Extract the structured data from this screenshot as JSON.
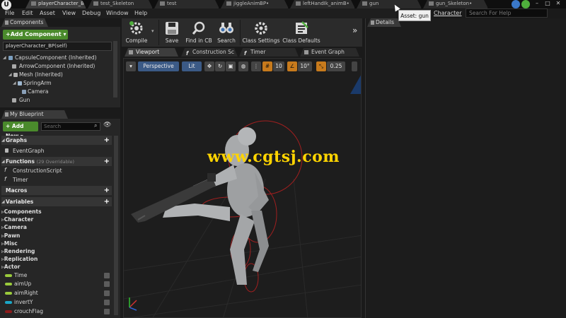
{
  "app": {
    "logo_letter": "U"
  },
  "doc_tabs": [
    {
      "label": "playerCharacter_BP",
      "active": true
    },
    {
      "label": "test_Skeleton",
      "active": false
    },
    {
      "label": "test",
      "active": false
    },
    {
      "label": "jiggleAnimBP•",
      "active": false
    },
    {
      "label": "leftHandIk_animB•",
      "active": false
    },
    {
      "label": "gun",
      "active": false
    },
    {
      "label": "gun_Skeleton•",
      "active": false
    }
  ],
  "menu": [
    "File",
    "Edit",
    "Asset",
    "View",
    "Debug",
    "Window",
    "Help"
  ],
  "tooltip": "Asset: gun",
  "parent_class": "Character",
  "help_search_placeholder": "Search For Help",
  "window_controls": {
    "minimize": "–",
    "maximize": "□",
    "close": "✕"
  },
  "components_panel": {
    "tab": "Components",
    "add_button": "+Add Component",
    "add_button_arrow": "▾",
    "search_value": "playerCharacter_BP(self)",
    "tree": [
      {
        "label": "CapsuleComponent (Inherited)",
        "depth": 0
      },
      {
        "label": "ArrowComponent (Inherited)",
        "depth": 1
      },
      {
        "label": "Mesh (Inherited)",
        "depth": 1
      },
      {
        "label": "SpringArm",
        "depth": 2
      },
      {
        "label": "Camera",
        "depth": 3
      },
      {
        "label": "Gun",
        "depth": 1
      }
    ]
  },
  "my_blueprint": {
    "tab": "My Blueprint",
    "add_new": "+ Add New",
    "add_new_arrow": "▾",
    "search_placeholder": "Search",
    "graphs": {
      "title": "Graphs",
      "items": [
        "EventGraph"
      ]
    },
    "functions": {
      "title": "Functions",
      "note": "(29 Overridable)",
      "items": [
        "ConstructionScript",
        "Timer"
      ]
    },
    "macros": {
      "title": "Macros"
    },
    "variables": {
      "title": "Variables",
      "categories": [
        "Components",
        "Character",
        "Camera",
        "Pawn",
        "Misc",
        "Rendering",
        "Replication",
        "Actor"
      ],
      "items": [
        {
          "name": "Time",
          "color": "#9acb3c"
        },
        {
          "name": "aimUp",
          "color": "#9acb3c"
        },
        {
          "name": "aimRight",
          "color": "#9acb3c"
        },
        {
          "name": "invertY",
          "color": "#1aa8c8"
        },
        {
          "name": "crouchFlag",
          "color": "#8c1a1a"
        }
      ]
    }
  },
  "toolbar": {
    "compile": "Compile",
    "save": "Save",
    "find": "Find in CB",
    "search": "Search",
    "class_settings": "Class Settings",
    "class_defaults": "Class Defaults",
    "more": "»"
  },
  "graph_tabs": [
    "Viewport",
    "Construction Sc",
    "Timer",
    "Event Graph"
  ],
  "viewport": {
    "perspective": "Perspective",
    "lit": "Lit",
    "grid_snap": "10",
    "rotation_snap": "10°",
    "scale_snap": "0.25",
    "watermark": "www.cgtsj.com"
  },
  "details": {
    "tab": "Details"
  }
}
